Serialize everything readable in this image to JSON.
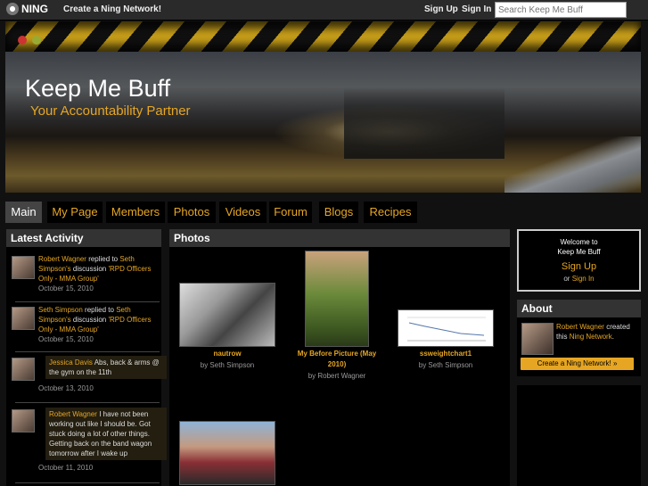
{
  "topbar": {
    "logo": "NING",
    "create_link": "Create a Ning Network!",
    "sign_up": "Sign Up",
    "sign_in": "Sign In",
    "search_placeholder": "Search Keep Me Buff"
  },
  "header": {
    "title": "Keep Me Buff",
    "tagline": "Your Accountability Partner"
  },
  "nav": {
    "tabs": [
      {
        "label": "Main",
        "active": true
      },
      {
        "label": "My Page"
      },
      {
        "label": "Members"
      },
      {
        "label": "Photos"
      },
      {
        "label": "Videos"
      },
      {
        "label": "Forum"
      },
      {
        "label": "Blogs"
      },
      {
        "label": "Recipes"
      }
    ]
  },
  "latest_activity": {
    "heading": "Latest Activity",
    "items": [
      {
        "actor": "Robert Wagner",
        "verb": "replied",
        "mid": "to",
        "target_owner": "Seth Simpson's",
        "mid2": "discussion",
        "target": "'RPD Officers Only - MMA Group'",
        "date": "October 15, 2010"
      },
      {
        "actor": "Seth Simpson",
        "verb": "replied",
        "mid": "to",
        "target_owner": "Seth Simpson's",
        "mid2": "discussion",
        "target": "'RPD Officers Only - MMA Group'",
        "date": "October 15, 2010"
      },
      {
        "actor": "Jessica Davis",
        "quote": "Abs, back & arms @ the gym on the 11th",
        "date": "October 13, 2010"
      },
      {
        "actor": "Robert Wagner",
        "quote": "I have not been working out like I should be. Got stuck doing a lot of other things. Getting back on the band wagon tomorrow after I wake up",
        "date": "October 11, 2010"
      }
    ]
  },
  "photos": {
    "heading": "Photos",
    "items": [
      {
        "title": "nautrow",
        "by": "by Seth Simpson"
      },
      {
        "title": "My Before Picture (May 2010)",
        "by": "by Robert Wagner"
      },
      {
        "title": "ssweightchart1",
        "by": "by Seth Simpson"
      },
      {
        "title": "",
        "by": ""
      }
    ]
  },
  "welcome": {
    "line1": "Welcome to",
    "line2": "Keep Me Buff",
    "sign_up": "Sign Up",
    "or": "or",
    "sign_in": "Sign In"
  },
  "about": {
    "heading": "About",
    "creator": "Robert Wagner",
    "created_text": "created this",
    "network": "Ning Network",
    "create_button": "Create a Ning Network! »"
  },
  "colors": {
    "accent": "#e6a623",
    "background": "#111111",
    "panel": "#000000",
    "panel_header": "#333333"
  }
}
